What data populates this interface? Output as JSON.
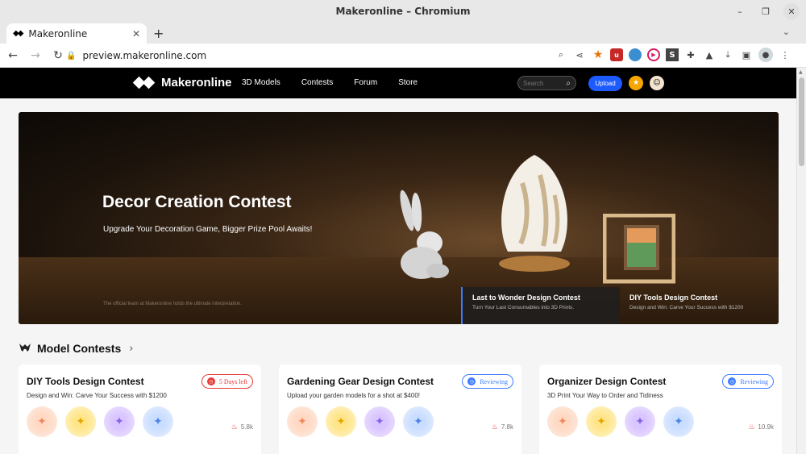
{
  "window": {
    "title": "Makeronline – Chromium"
  },
  "tab": {
    "title": "Makeronline",
    "new_tab": "+"
  },
  "omnibox": {
    "url": "preview.makeronline.com"
  },
  "site": {
    "logo_text": "Makeronline",
    "nav": [
      "3D Models",
      "Contests",
      "Forum",
      "Store"
    ],
    "search_placeholder": "Search",
    "upload_label": "Upload"
  },
  "hero": {
    "title": "Decor Creation Contest",
    "subtitle": "Upgrade Your Decoration Game, Bigger Prize Pool Awaits!",
    "note": "The official team at Makeronline holds the ultimate interpretation.",
    "tabs": [
      {
        "title": "Last to Wonder Design Contest",
        "desc": "Turn Your Last Consumables into 3D Prints."
      },
      {
        "title": "DIY Tools Design Contest",
        "desc": "Design and Win: Carve Your Success with $1200"
      }
    ]
  },
  "section": {
    "title": "Model Contests"
  },
  "cards": [
    {
      "title": "DIY Tools Design Contest",
      "desc": "Design and Win: Carve Your Success with $1200",
      "badge": "5 Days left",
      "stat": "5.8k"
    },
    {
      "title": "Gardening Gear Design Contest",
      "desc": "Upload your garden models for a shot at $400!",
      "badge": "Reviewing",
      "stat": "7.8k"
    },
    {
      "title": "Organizer Design Contest",
      "desc": "3D Print Your Way to Order and Tidiness",
      "badge": "Reviewing",
      "stat": "10.9k"
    }
  ],
  "colors": {
    "accent": "#1e5bff",
    "deadline": "#e53935",
    "reviewing": "#3e7bff"
  }
}
